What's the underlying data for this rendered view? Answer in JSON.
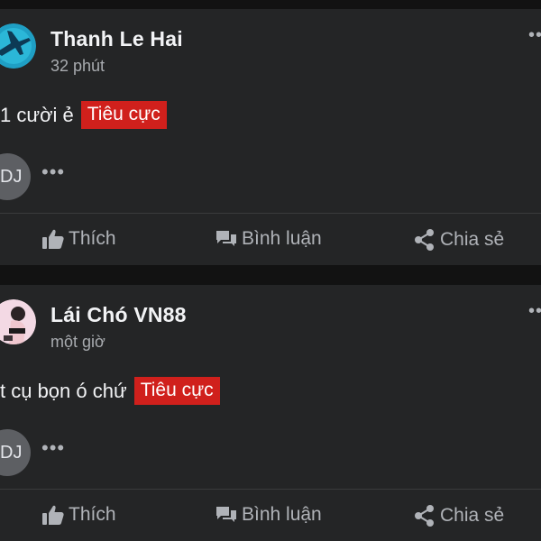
{
  "posts": [
    {
      "author": "Thanh Le Hai",
      "time": "32 phút",
      "content": "1 cười ẻ",
      "tag": "Tiêu cực",
      "reaction_label": "DJ",
      "more": "•••",
      "actions": {
        "like": "Thích",
        "comment": "Bình luận",
        "share": "Chia sẻ"
      }
    },
    {
      "author": "Lái Chó VN88",
      "time": "một giờ",
      "content": "t cụ bọn ó chứ",
      "tag": "Tiêu cực",
      "reaction_label": "DJ",
      "more": "•••",
      "actions": {
        "like": "Thích",
        "comment": "Bình luận",
        "share": "Chia sẻ"
      }
    }
  ],
  "colors": {
    "background": "#121212",
    "card": "#242526",
    "tag": "#d0201c",
    "muted": "#b0b3b8"
  },
  "icons": [
    "plane-avatar-icon",
    "person-avatar-icon",
    "thumbs-up-icon",
    "comment-icon",
    "share-icon",
    "more-icon"
  ]
}
